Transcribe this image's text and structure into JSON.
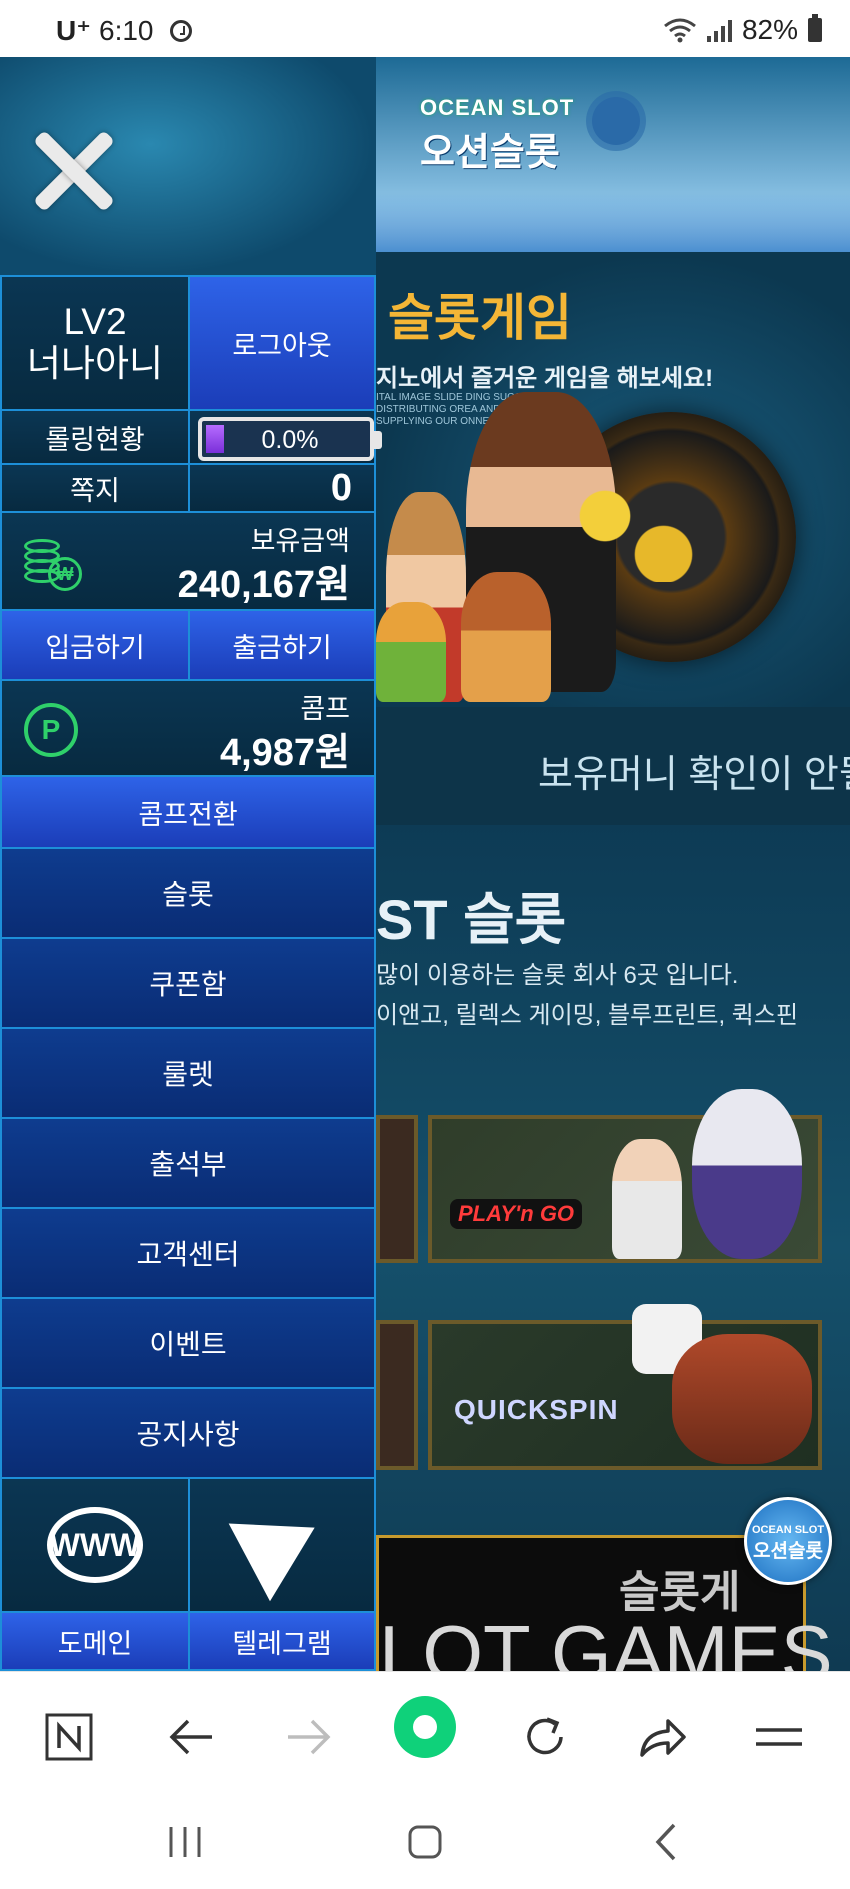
{
  "status_bar": {
    "carrier": "U⁺",
    "time": "6:10",
    "battery": "82%"
  },
  "site": {
    "logo_top": "OCEAN SLOT",
    "logo_kr": "오션슬롯",
    "banner_title": "슬롯게임",
    "banner_subtitle": "지노에서 즐거운 게임을 해보세요!",
    "banner_small": "ITAL IMAGE SLIDE DING SUCCESS IN DISTRIBUTING OREA AND IN SUPPLYING OUR ONNEL PARTNERS.",
    "notice": "보유머니 확인이 안될",
    "best_title": "ST 슬롯",
    "best_line1": "많이 이용하는 슬롯 회사 6곳 입니다.",
    "best_line2": "이앤고, 릴렉스 게이밍, 블루프린트, 퀵스핀",
    "card_playngo": "PLAY'n GO",
    "card_quickspin": "QUICKSPIN",
    "games_kr": "슬롯게",
    "games_en": "LOT GAMES",
    "badge_top": "OCEAN SLOT",
    "badge_kr": "오션슬롯"
  },
  "drawer": {
    "level": "LV2",
    "username": "너나아니",
    "logout": "로그아웃",
    "rolling_label": "롤링현황",
    "rolling_value": "0.0%",
    "rolling_fraction": 0.0,
    "message_label": "쪽지",
    "message_count": "0",
    "balance_label": "보유금액",
    "balance_value": "240,167원",
    "deposit": "입금하기",
    "withdraw": "출금하기",
    "comp_label": "콤프",
    "comp_value": "4,987원",
    "comp_convert": "콤프전환",
    "menu": [
      "슬롯",
      "쿠폰함",
      "룰렛",
      "출석부",
      "고객센터",
      "이벤트",
      "공지사항"
    ],
    "domain_label": "도메인",
    "telegram_label": "텔레그램",
    "www_text": "WWW"
  },
  "colors": {
    "drawer_border": "#1d8fd8",
    "button_blue": "#2e63e8",
    "icon_green": "#2fd06a",
    "browser_green": "#0fd17a"
  },
  "browser": {
    "icons": [
      "naver-icon",
      "back-icon",
      "forward-icon",
      "home-icon",
      "refresh-icon",
      "share-icon",
      "menu-icon"
    ]
  },
  "system_nav": {
    "icons": [
      "recents-icon",
      "home-icon",
      "back-icon"
    ]
  }
}
